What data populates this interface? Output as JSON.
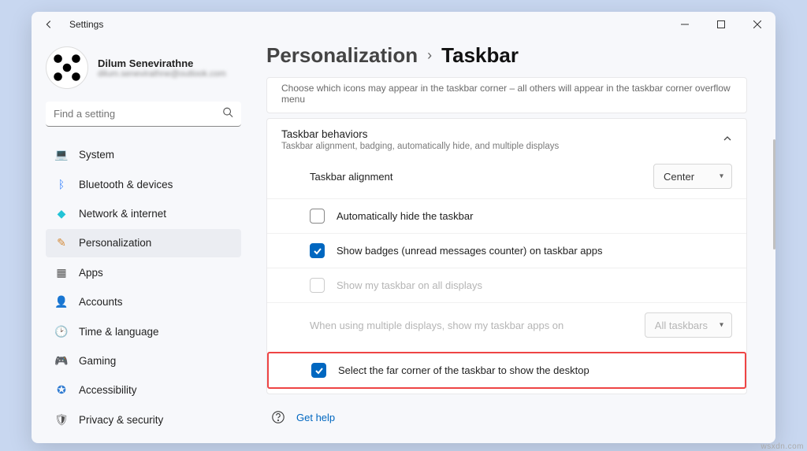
{
  "titlebar": {
    "title": "Settings"
  },
  "profile": {
    "name": "Dilum Senevirathne",
    "email": "dilum.senevirathne@outlook.com"
  },
  "search": {
    "placeholder": "Find a setting"
  },
  "nav": {
    "items": [
      {
        "label": "System",
        "icon": "💻",
        "color": "#3a86ff"
      },
      {
        "label": "Bluetooth & devices",
        "icon": "ᛒ",
        "color": "#3a86ff"
      },
      {
        "label": "Network & internet",
        "icon": "◆",
        "color": "#22c3d6"
      },
      {
        "label": "Personalization",
        "icon": "✎",
        "color": "#d58b39"
      },
      {
        "label": "Apps",
        "icon": "▦",
        "color": "#555"
      },
      {
        "label": "Accounts",
        "icon": "👤",
        "color": "#3fae6c"
      },
      {
        "label": "Time & language",
        "icon": "🕑",
        "color": "#555"
      },
      {
        "label": "Gaming",
        "icon": "🎮",
        "color": "#555"
      },
      {
        "label": "Accessibility",
        "icon": "✪",
        "color": "#2f7bd1"
      },
      {
        "label": "Privacy & security",
        "icon": "🛡",
        "color": "#555"
      }
    ],
    "active_index": 3
  },
  "breadcrumb": {
    "parent": "Personalization",
    "current": "Taskbar"
  },
  "overflow": {
    "desc": "Choose which icons may appear in the taskbar corner – all others will appear in the taskbar corner overflow menu"
  },
  "behaviors": {
    "title": "Taskbar behaviors",
    "subtitle": "Taskbar alignment, badging, automatically hide, and multiple displays",
    "alignment": {
      "label": "Taskbar alignment",
      "value": "Center"
    },
    "auto_hide": {
      "label": "Automatically hide the taskbar",
      "checked": false
    },
    "badges": {
      "label": "Show badges (unread messages counter) on taskbar apps",
      "checked": true
    },
    "all_displays": {
      "label": "Show my taskbar on all displays",
      "checked": false,
      "disabled": true
    },
    "multi_where": {
      "label": "When using multiple displays, show my taskbar apps on",
      "value": "All taskbars",
      "disabled": true
    },
    "far_corner": {
      "label": "Select the far corner of the taskbar to show the desktop",
      "checked": true
    }
  },
  "help": {
    "label": "Get help"
  },
  "watermark": "wsxdn.com"
}
